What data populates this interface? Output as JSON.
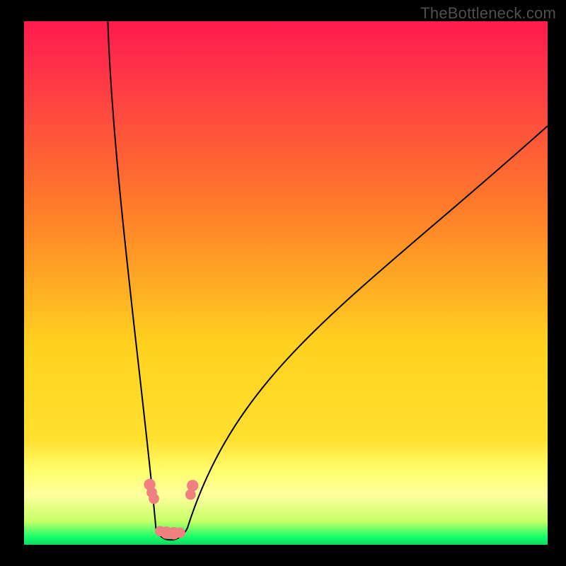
{
  "watermark": "TheBottleneck.com",
  "colors": {
    "frame": "#000000",
    "gradient_top": "#ff1a4d",
    "gradient_mid1": "#ff7a2a",
    "gradient_mid2": "#ffe030",
    "gradient_band": "#ffff9d",
    "gradient_bottom": "#16ff6b",
    "curve": "#000000",
    "marker": "#f08080"
  },
  "chart_data": {
    "type": "line",
    "title": "",
    "xlabel": "",
    "ylabel": "",
    "xlim": [
      0,
      100
    ],
    "ylim": [
      0,
      100
    ],
    "curve": {
      "left_branch_top": {
        "x": 16,
        "y": 100
      },
      "vertex": {
        "x": 28,
        "y": 0
      },
      "right_branch_top": {
        "x": 100,
        "y": 80
      }
    },
    "markers": [
      {
        "x": 24.0,
        "y": 11.5,
        "r": 1.1
      },
      {
        "x": 24.4,
        "y": 10.0,
        "r": 1.0
      },
      {
        "x": 24.8,
        "y": 8.8,
        "r": 1.0
      },
      {
        "x": 26.0,
        "y": 2.6,
        "r": 1.0
      },
      {
        "x": 27.2,
        "y": 2.3,
        "r": 1.2
      },
      {
        "x": 28.6,
        "y": 2.2,
        "r": 1.2
      },
      {
        "x": 29.8,
        "y": 2.3,
        "r": 1.0
      },
      {
        "x": 31.8,
        "y": 9.6,
        "r": 1.0
      },
      {
        "x": 32.2,
        "y": 11.3,
        "r": 1.1
      }
    ],
    "gradient_stops": [
      {
        "offset": 0.0,
        "color": "#ff1a4d"
      },
      {
        "offset": 0.08,
        "color": "#ff2f4a"
      },
      {
        "offset": 0.35,
        "color": "#ff7a2a"
      },
      {
        "offset": 0.62,
        "color": "#ffd21f"
      },
      {
        "offset": 0.8,
        "color": "#ffe030"
      },
      {
        "offset": 0.86,
        "color": "#ffff70"
      },
      {
        "offset": 0.905,
        "color": "#ffff9d"
      },
      {
        "offset": 0.955,
        "color": "#c6ff66"
      },
      {
        "offset": 0.985,
        "color": "#16ff6b"
      },
      {
        "offset": 1.0,
        "color": "#0fd860"
      }
    ]
  }
}
